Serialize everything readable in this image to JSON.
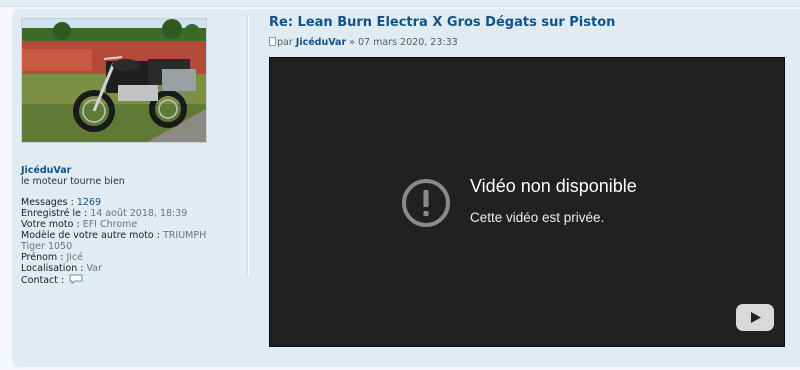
{
  "post": {
    "title": "Re: Lean Burn Electra X Gros Dégats sur Piston",
    "meta_prefix": "par ",
    "author": "JicéduVar",
    "meta_sep": " » ",
    "date": "07 mars 2020, 23:33"
  },
  "profile": {
    "username": "JicéduVar",
    "rank": "le moteur tourne bien",
    "messages_label": "Messages :",
    "messages_value": "1269",
    "registered_label": "Enregistré le :",
    "registered_value": "14 août 2018, 18:39",
    "bike_label": "Votre moto :",
    "bike_value": "EFI Chrome",
    "other_bike_label": "Modèle de votre autre moto :",
    "other_bike_value_1": "TRIUMPH",
    "other_bike_value_2": "Tiger 1050",
    "firstname_label": "Prénom :",
    "firstname_value": "Jicé",
    "location_label": "Localisation :",
    "location_value": "Var",
    "contact_label": "Contact :",
    "contact_icon": "speech-bubble-icon"
  },
  "video": {
    "title": "Vidéo non disponible",
    "message": "Cette vidéo est privée.",
    "status_icon": "alert-circle-icon",
    "brand_icon": "youtube-logo-icon"
  },
  "colors": {
    "post_bg": "#e1ebf2",
    "link": "#105289",
    "video_bg": "#212121"
  }
}
